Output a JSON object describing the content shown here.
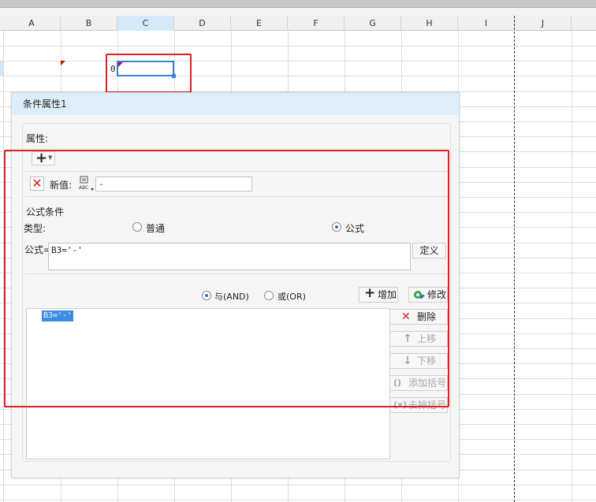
{
  "sheet": {
    "columns": [
      "A",
      "B",
      "C",
      "D",
      "E",
      "F",
      "G",
      "H",
      "I",
      "J"
    ],
    "selected_column": "C",
    "cell_c3_value": "0"
  },
  "dialog": {
    "title": "条件属性1",
    "section_properties": "属性:",
    "new_value_label": "新值:",
    "new_value_text": "-",
    "formula_condition_title": "公式条件",
    "type_label": "类型:",
    "type_options": [
      "普通",
      "公式"
    ],
    "type_selected": "公式",
    "formula_label": "公式=",
    "formula_text": "B3='-'",
    "define_button": "定义",
    "logic_options": [
      "与(AND)",
      "或(OR)"
    ],
    "logic_selected": "与(AND)",
    "add_button": "增加",
    "modify_button": "修改",
    "delete_button": "删除",
    "move_up_button": "上移",
    "move_down_button": "下移",
    "add_bracket_button": "添加括号",
    "remove_bracket_button": "去掉括号",
    "condition_list": [
      "B3='-'"
    ]
  },
  "icons": {
    "plus": "plus-icon",
    "delete": "red-x-icon",
    "abc": "abc-format-icon",
    "modify": "gear-edit-icon",
    "up": "arrow-up-icon",
    "down": "arrow-down-icon",
    "bracket": "bracket-icon"
  },
  "colors": {
    "accent": "#3c7fd6",
    "highlight_box": "#e02020",
    "title_bar": "#dbeefa"
  }
}
